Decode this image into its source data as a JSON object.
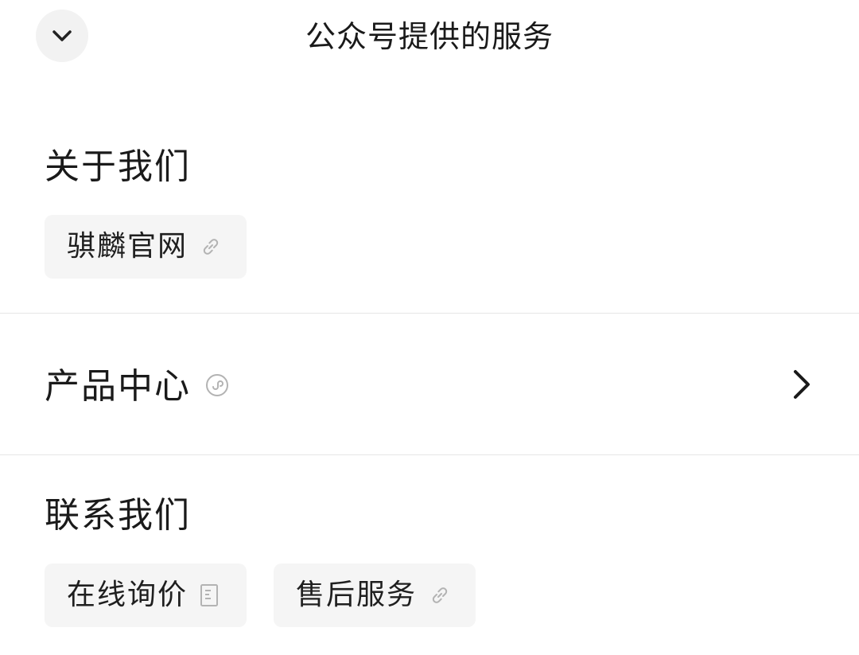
{
  "header": {
    "title": "公众号提供的服务",
    "collapse_icon": "chevron-down-icon"
  },
  "sections": {
    "about": {
      "title": "关于我们",
      "items": [
        {
          "label": "骐麟官网",
          "icon": "link-icon"
        }
      ]
    },
    "products": {
      "title": "产品中心",
      "badge_icon": "mini-program-icon",
      "arrow_icon": "chevron-right-icon"
    },
    "contact": {
      "title": "联系我们",
      "items": [
        {
          "label": "在线询价",
          "icon": "document-icon"
        },
        {
          "label": "售后服务",
          "icon": "link-icon"
        }
      ]
    }
  },
  "colors": {
    "background": "#ffffff",
    "chip_background": "#f5f5f5",
    "button_background": "#f2f2f2",
    "divider": "#e6e6e6",
    "text": "#1a1a1a",
    "icon_muted": "#b3b3b3"
  }
}
